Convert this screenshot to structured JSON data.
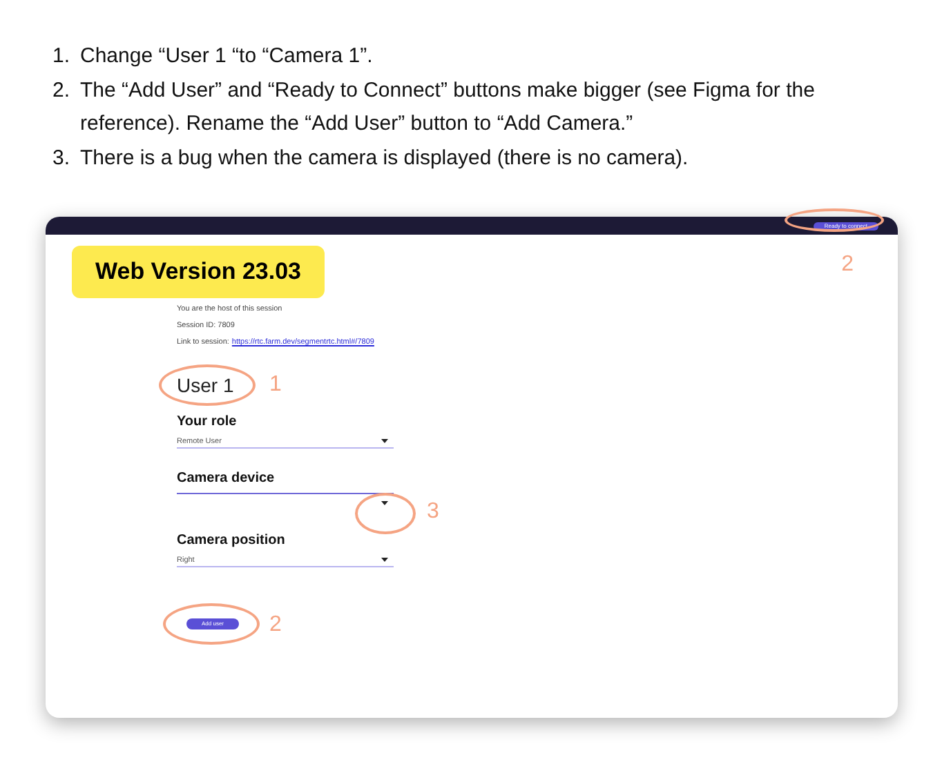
{
  "instructions": [
    {
      "number": "1.",
      "text": "Change “User 1 “to “Camera 1”."
    },
    {
      "number": "2.",
      "text": "The “Add User” and “Ready to Connect” buttons make bigger (see Figma for the reference). Rename the “Add User” button to “Add Camera.”"
    },
    {
      "number": "3.",
      "text": "There is a bug when the camera is displayed (there is no camera)."
    }
  ],
  "screenshot": {
    "header": {
      "button": "Ready to connect",
      "annotation": "2"
    },
    "version_badge": "Web Version 23.03",
    "session_lines": [
      "You are the host of this session",
      "Session ID: 7809"
    ],
    "link": {
      "label": "Link to session:",
      "url": "https://rtc.farm.dev/segmentrtc.html#/7809"
    },
    "user_title": {
      "text": "User 1",
      "annotation": "1"
    },
    "fields": [
      {
        "label": "Your role",
        "value": "Remote User"
      },
      {
        "label": "Camera device",
        "annotation": "3"
      },
      {
        "label": "Camera position",
        "value": "Right"
      }
    ],
    "add_button": {
      "label": "Add user",
      "annotation": "2"
    }
  }
}
